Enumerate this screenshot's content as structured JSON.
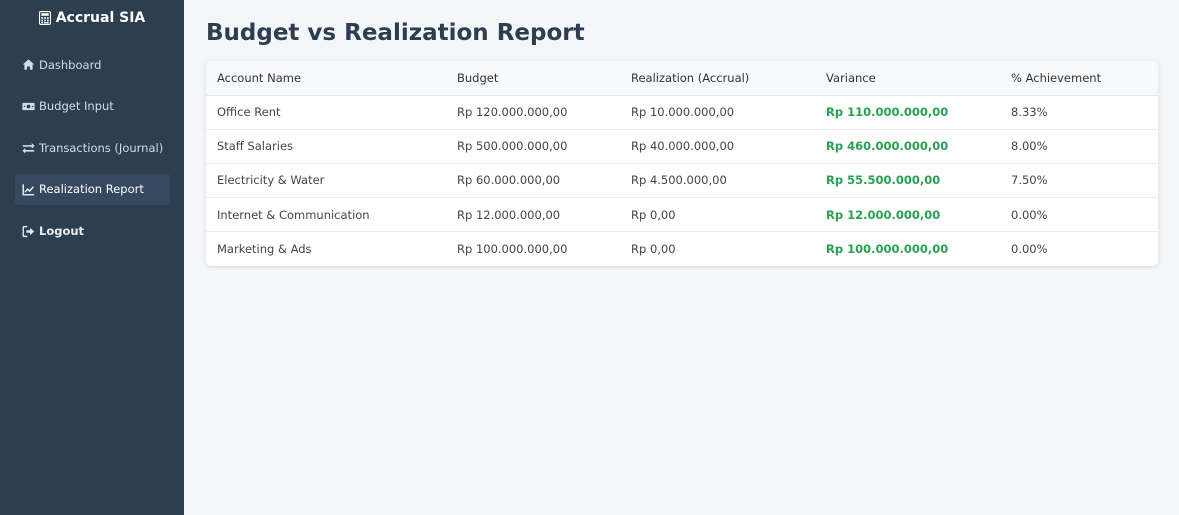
{
  "app": {
    "brand": "Accrual SIA"
  },
  "sidebar": {
    "items": [
      {
        "label": "Dashboard",
        "icon": "home-icon"
      },
      {
        "label": "Budget Input",
        "icon": "money-bill-icon"
      },
      {
        "label": "Transactions (Journal)",
        "icon": "exchange-icon"
      },
      {
        "label": "Realization Report",
        "icon": "chart-line-icon",
        "active": true
      },
      {
        "label": "Logout",
        "icon": "sign-out-icon"
      }
    ]
  },
  "main": {
    "title": "Budget vs Realization Report",
    "table": {
      "headers": [
        "Account Name",
        "Budget",
        "Realization (Accrual)",
        "Variance",
        "% Achievement"
      ],
      "rows": [
        [
          "Office Rent",
          "Rp 120.000.000,00",
          "Rp 10.000.000,00",
          "Rp 110.000.000,00",
          "8.33%"
        ],
        [
          "Staff Salaries",
          "Rp 500.000.000,00",
          "Rp 40.000.000,00",
          "Rp 460.000.000,00",
          "8.00%"
        ],
        [
          "Electricity & Water",
          "Rp 60.000.000,00",
          "Rp 4.500.000,00",
          "Rp 55.500.000,00",
          "7.50%"
        ],
        [
          "Internet & Communication",
          "Rp 12.000.000,00",
          "Rp 0,00",
          "Rp 12.000.000,00",
          "0.00%"
        ],
        [
          "Marketing & Ads",
          "Rp 100.000.000,00",
          "Rp 0,00",
          "Rp 100.000.000,00",
          "0.00%"
        ]
      ]
    }
  },
  "colors": {
    "sidebar_bg": "#2c3e50",
    "active_item_bg": "#34495e",
    "variance_positive": "#27a052",
    "page_bg": "#f4f6f9"
  }
}
